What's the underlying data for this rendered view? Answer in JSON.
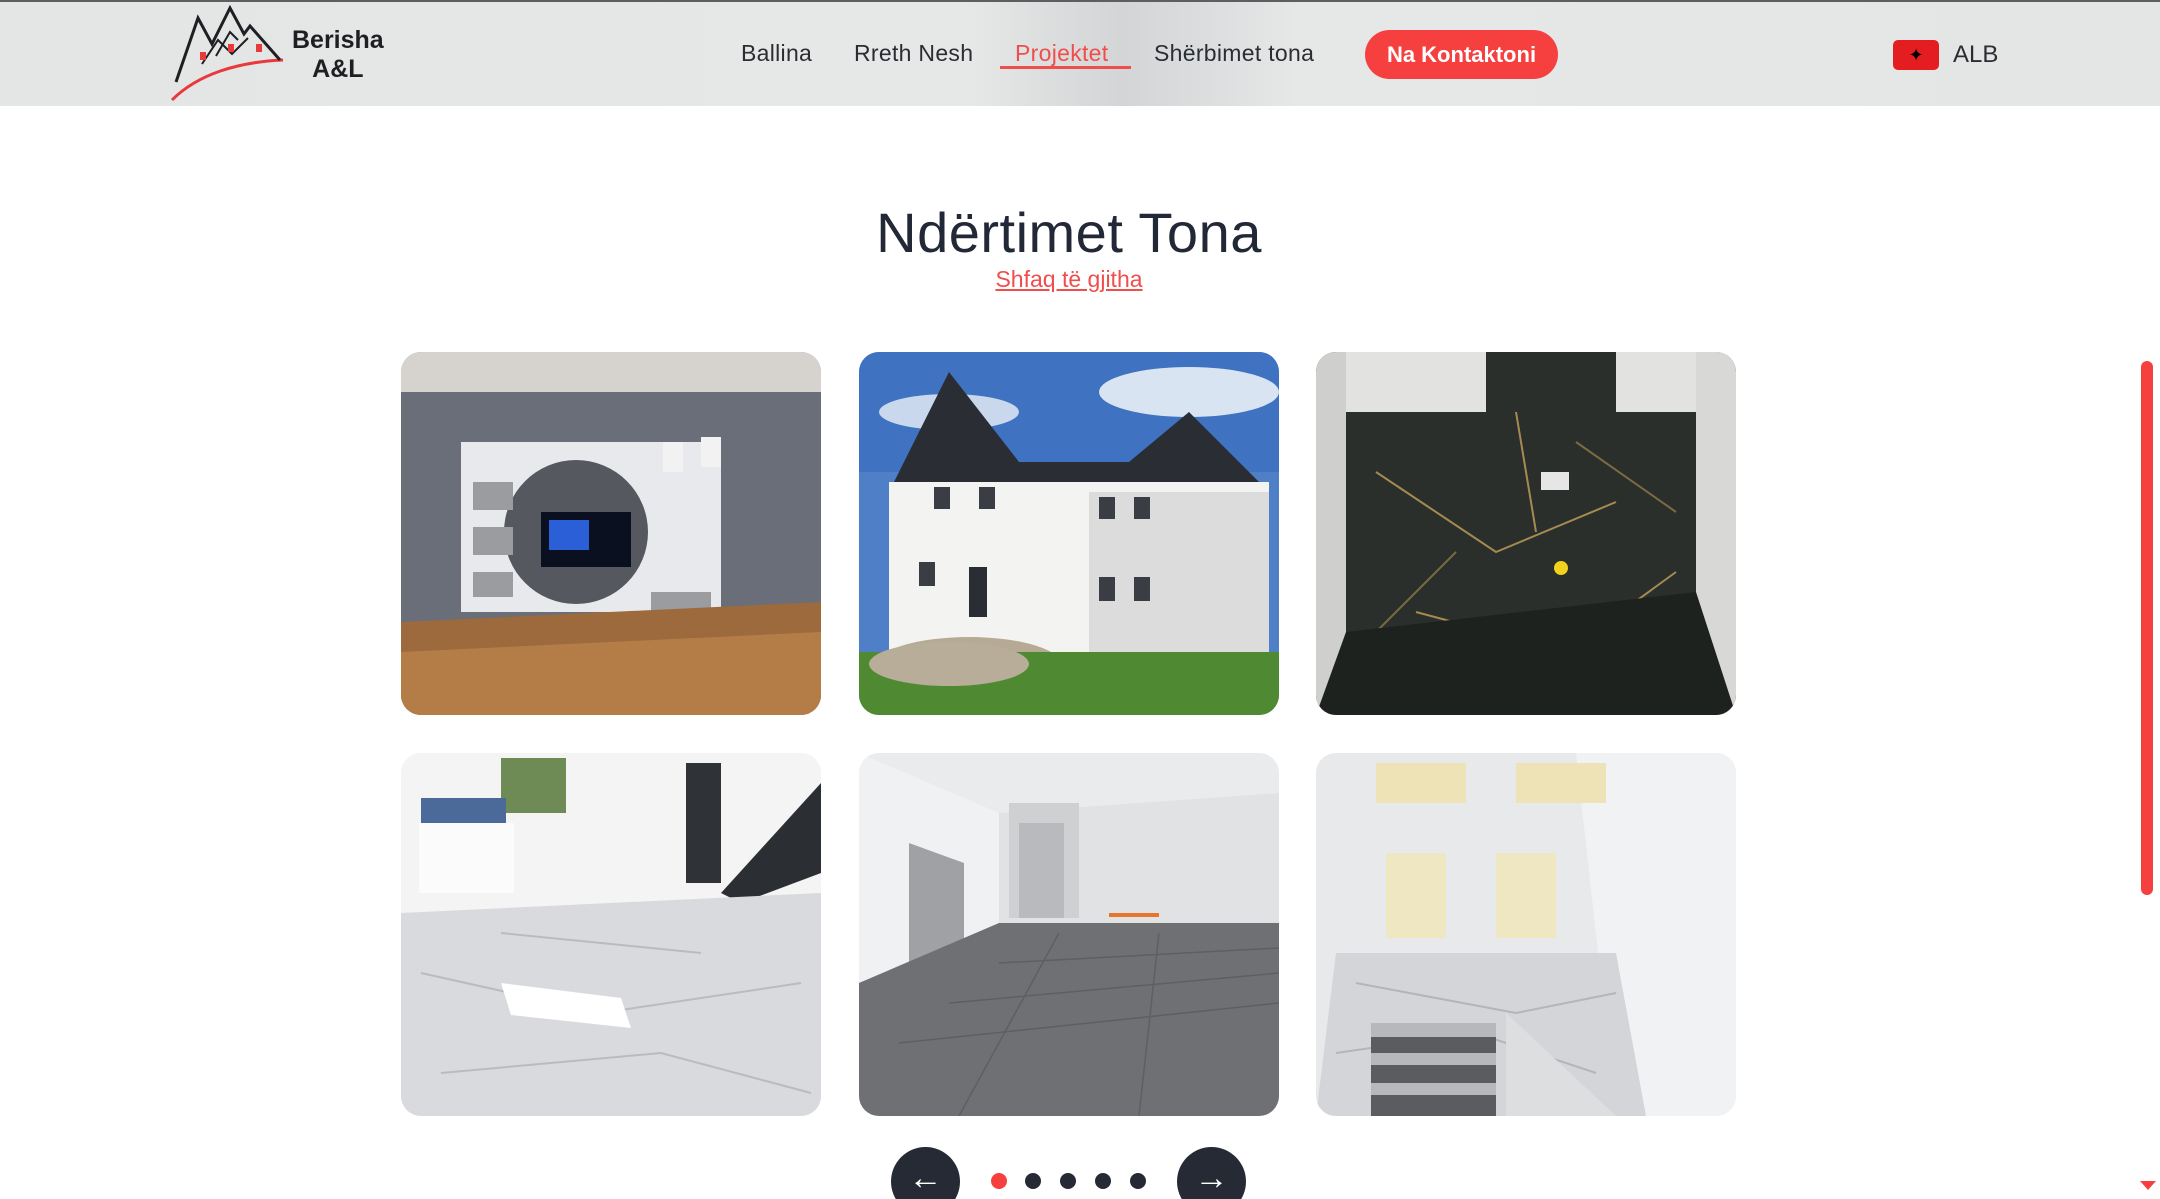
{
  "header": {
    "logo_text_line1": "Berisha",
    "logo_text_line2": "A&L",
    "nav": [
      {
        "label": "Ballina",
        "active": false
      },
      {
        "label": "Rreth Nesh",
        "active": false
      },
      {
        "label": "Projektet",
        "active": true
      },
      {
        "label": "Shërbimet tona",
        "active": false
      }
    ],
    "cta_label": "Na Kontaktoni",
    "language": {
      "label": "ALB",
      "flag": "albania-flag-icon"
    }
  },
  "section": {
    "title": "Ndërtimet Tona",
    "show_all_label": "Shfaq të gjitha"
  },
  "gallery": [
    {
      "name": "living-room-tv-wall-photo"
    },
    {
      "name": "white-house-exterior-photo"
    },
    {
      "name": "dark-marble-bathroom-photo"
    },
    {
      "name": "marble-floor-staircase-photo"
    },
    {
      "name": "grey-tile-empty-room-photo"
    },
    {
      "name": "marble-stairs-skylight-photo"
    }
  ],
  "carousel": {
    "prev_icon": "arrow-left-icon",
    "next_icon": "arrow-right-icon",
    "prev_glyph": "←",
    "next_glyph": "→",
    "page_count": 5,
    "active_page": 1
  },
  "colors": {
    "accent": "#f6403f",
    "dark": "#252a35",
    "header_bg": "#e5e7e7"
  }
}
